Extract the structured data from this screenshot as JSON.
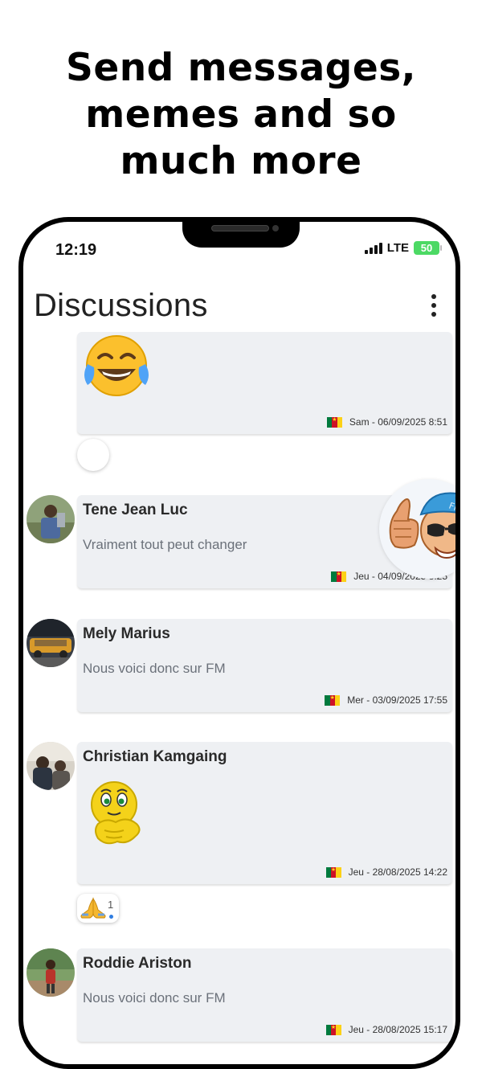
{
  "promo": {
    "line1": "Send messages,",
    "line2": "memes and so",
    "line3": "much more"
  },
  "status_bar": {
    "time": "12:19",
    "network": "LTE",
    "battery": "50"
  },
  "header": {
    "title": "Discussions",
    "menu_icon": "more-vertical-icon"
  },
  "messages": [
    {
      "sender": "",
      "content_type": "emoji",
      "emoji_icon": "face-with-tears-of-joy-icon",
      "timestamp": "Sam - 06/09/2025 8:51",
      "country_flag": "cameroon-flag-icon"
    },
    {
      "sender": "Tene Jean Luc",
      "text": "Vraiment tout peut changer",
      "timestamp": "Jeu - 04/09/2025 8:25",
      "country_flag": "cameroon-flag-icon"
    },
    {
      "sender": "Mely Marius",
      "text": "Nous voici donc sur FM",
      "timestamp": "Mer - 03/09/2025 17:55",
      "country_flag": "cameroon-flag-icon"
    },
    {
      "sender": "Christian Kamgaing",
      "content_type": "emoji",
      "emoji_icon": "rubbing-hands-smiley-icon",
      "timestamp": "Jeu - 28/08/2025 14:22",
      "country_flag": "cameroon-flag-icon"
    },
    {
      "sender": "Roddie Ariston",
      "text": "Nous voici donc sur FM",
      "timestamp": "Jeu - 28/08/2025 15:17",
      "country_flag": "cameroon-flag-icon"
    }
  ],
  "reactions": {
    "christian": {
      "emoji_icon": "folded-hands-icon",
      "count": "1"
    }
  },
  "sticker": {
    "icon": "fm-mascot-thumbs-up-icon",
    "cap_text": "FM"
  },
  "colors": {
    "card_bg": "#eef0f3",
    "text_dark": "#2a2a2a",
    "text_muted": "#6b717a",
    "battery": "#4cd964"
  }
}
